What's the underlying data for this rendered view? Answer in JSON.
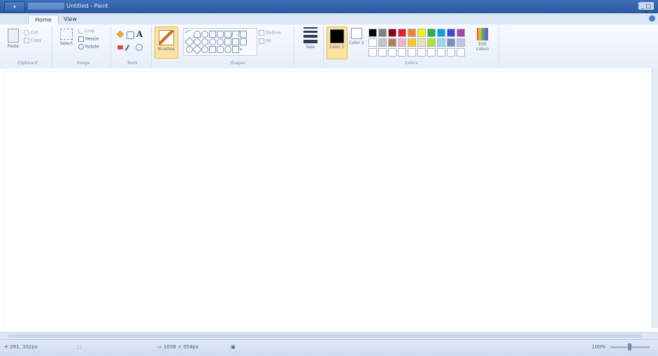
{
  "window": {
    "app_menu_label": "▾",
    "title": "Untitled - Paint",
    "controls": "_ □ X"
  },
  "tabs": [
    {
      "label": "Home"
    },
    {
      "label": "View"
    }
  ],
  "ribbon": {
    "clipboard": {
      "paste": "Paste",
      "cut": "Cut",
      "copy": "Copy",
      "group_label": "Clipboard"
    },
    "image": {
      "select": "Select",
      "crop": "Crop",
      "resize": "Resize",
      "rotate": "Rotate",
      "group_label": "Image"
    },
    "tools": {
      "group_label": "Tools"
    },
    "brushes": {
      "label": "Brushes"
    },
    "shapes": {
      "outline": "Outline",
      "fill": "Fill",
      "group_label": "Shapes"
    },
    "size": {
      "label": "Size"
    },
    "colors": {
      "color1": "Color 1",
      "color2": "Color 2",
      "edit_colors": "Edit colors",
      "group_label": "Colors",
      "palette_row1": [
        "#000000",
        "#7f7f7f",
        "#880015",
        "#ed1c24",
        "#ff7f27",
        "#fff200",
        "#22b14c",
        "#00a2e8",
        "#3f48cc",
        "#a349a4"
      ],
      "palette_row2": [
        "#ffffff",
        "#c3c3c3",
        "#b97a57",
        "#ffaec9",
        "#ffc90e",
        "#efe4b0",
        "#b5e61d",
        "#99d9ea",
        "#7092be",
        "#c8bfe7"
      ]
    }
  },
  "status": {
    "cursor_pos": "291, 332px",
    "canvas_size": "1008 × 554px",
    "zoom": "100%"
  }
}
